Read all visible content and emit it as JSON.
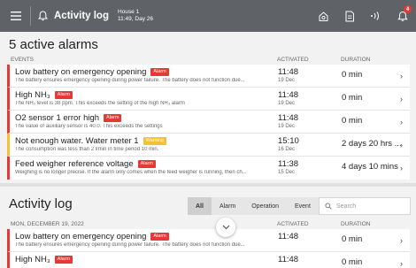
{
  "topbar": {
    "title": "Activity log",
    "location": "House 1",
    "datetime": "11:49, Day 26",
    "notification_count": "4"
  },
  "alarms": {
    "heading": "5 active alarms",
    "col_events": "EVENTS",
    "col_activated": "ACTIVATED",
    "col_duration": "DURATION",
    "rows": [
      {
        "title": "Low battery on emergency opening",
        "tag": "Alarm",
        "desc": "The battery ensures emergency opening during power failure. The battery does not function due...",
        "time": "11:48",
        "date": "19 Dec",
        "duration": "0 min"
      },
      {
        "title": "High NH₃",
        "tag": "Alarm",
        "desc": "The NH₃ level is 38 ppm. This exceeds the setting of the high NH₃ alarm",
        "time": "11:48",
        "date": "19 Dec",
        "duration": "0 min"
      },
      {
        "title": "O2 sensor 1 error high",
        "tag": "Alarm",
        "desc": "The value of auxiliary sensor is 40.0. This exceeds the settings",
        "time": "11:48",
        "date": "19 Dec",
        "duration": "0 min"
      },
      {
        "title": "Not enough water. Water meter 1",
        "tag": "Warning",
        "desc": "The consumption was less than 2 l/min in time period 10 min.",
        "time": "15:10",
        "date": "16 Dec",
        "duration": "2 days 20 hrs ..."
      },
      {
        "title": "Feed weigher reference voltage",
        "tag": "Alarm",
        "desc": "Weighing is no longer precise. If the alarm only comes when the feed weigher is running, then ch...",
        "time": "11:38",
        "date": "15 Dec",
        "duration": "4 days 10 mins"
      }
    ]
  },
  "log": {
    "heading": "Activity log",
    "filters": [
      "All",
      "Alarm",
      "Operation",
      "Event"
    ],
    "search_placeholder": "Search",
    "date_header": "MON, DECEMBER 19, 2022",
    "col_activated": "ACTIVATED",
    "col_duration": "DURATION",
    "rows": [
      {
        "title": "Low battery on emergency opening",
        "tag": "Alarm",
        "desc": "The battery ensures emergency opening during power failure. The battery does not function due...",
        "time": "11:48",
        "duration": "0 min"
      },
      {
        "title": "High NH₃",
        "tag": "Alarm",
        "time": "11:48",
        "duration": "0 min"
      }
    ]
  },
  "colors": {
    "alarm": "#e53935",
    "warning": "#f2c230",
    "topbar": "#5f6266"
  }
}
